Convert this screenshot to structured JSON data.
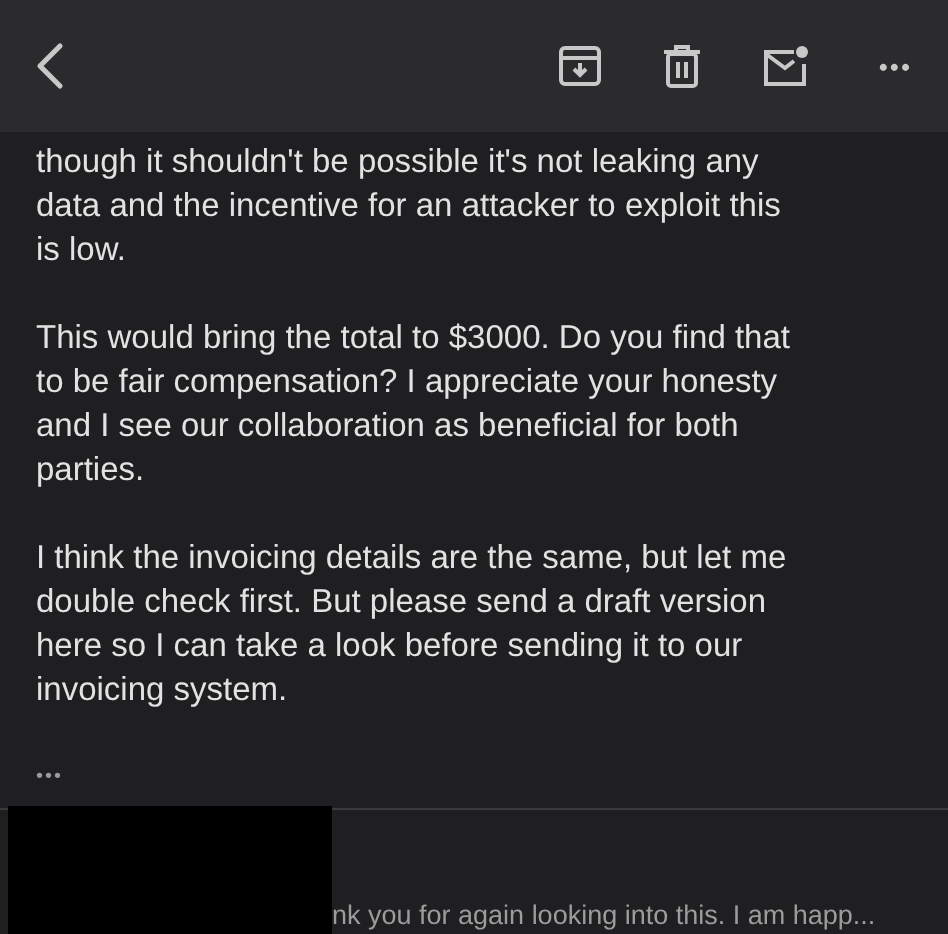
{
  "toolbar": {
    "more": "•••"
  },
  "message_body": [
    [
      "though it shouldn't be possible it's not leaking any",
      "data and the incentive for an attacker to exploit this",
      "is low."
    ],
    [
      "This would bring the total to $3000. Do you find that",
      "to be fair compensation? I appreciate your honesty",
      "and I see our collaboration as beneficial for both",
      "parties."
    ],
    [
      "I think the invoicing details are the same, but let me",
      "double check first. But please send a draft version",
      "here so I can take a look before sending it to our",
      "invoicing system."
    ]
  ],
  "quoted_toggle": "•••",
  "next_message": {
    "snippet": "nk you for again looking into this. I am happ..."
  }
}
